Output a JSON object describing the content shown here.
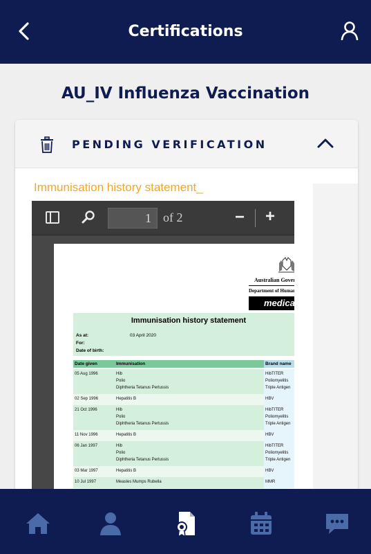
{
  "header": {
    "title": "Certifications"
  },
  "page": {
    "title": "AU_IV Influenza Vaccination"
  },
  "card": {
    "status": "PENDING VERIFICATION",
    "document_title": "Immunisation history statement_"
  },
  "viewer": {
    "page_number": "1",
    "page_total": "of 2"
  },
  "document": {
    "gov_line1": "Australian Gover",
    "gov_line2": "Department of Human",
    "medicare": "medicare",
    "title": "Immunisation history statement",
    "as_at_label": "As at:",
    "as_at_value": "03 April 2020",
    "for_label": "For:",
    "dob_label": "Date of birth:",
    "columns": [
      "Date given",
      "Immunisation",
      "Brand name"
    ],
    "rows": [
      {
        "date": "05 Aug 1996",
        "immunisations": [
          "Hib",
          "Polio",
          "Diphtheria Tetanus Pertussis"
        ],
        "brands": [
          "HibTITER",
          "Poliomyelitis",
          "Triple Antigen"
        ]
      },
      {
        "date": "02 Sep 1996",
        "immunisations": [
          "Hepatitis B"
        ],
        "brands": [
          "HBV"
        ]
      },
      {
        "date": "21 Oct 1996",
        "immunisations": [
          "Hib",
          "Polio",
          "Diphtheria Tetanus Pertussis"
        ],
        "brands": [
          "HibTITER",
          "Poliomyelitis",
          "Triple Antigen"
        ]
      },
      {
        "date": "11 Nov 1996",
        "immunisations": [
          "Hepatitis B"
        ],
        "brands": [
          "HBV"
        ]
      },
      {
        "date": "06 Jan 1997",
        "immunisations": [
          "Hib",
          "Polio",
          "Diphtheria Tetanus Pertussis"
        ],
        "brands": [
          "HibTITER",
          "Poliomyelitis",
          "Triple Antigen"
        ]
      },
      {
        "date": "03 Mar 1997",
        "immunisations": [
          "Hepatitis B"
        ],
        "brands": [
          "HBV"
        ]
      },
      {
        "date": "10 Jul 1997",
        "immunisations": [
          "Measles Mumps Rubella"
        ],
        "brands": [
          "MMR"
        ]
      }
    ]
  },
  "tabs": [
    {
      "icon": "home-icon"
    },
    {
      "icon": "profile-icon"
    },
    {
      "icon": "certificate-icon",
      "active": true
    },
    {
      "icon": "calendar-icon"
    },
    {
      "icon": "chat-icon"
    }
  ],
  "colors": {
    "navy": "#0f1c52",
    "accent": "#f5a623",
    "tab_inactive": "#4a6aa8",
    "tab_active": "#ffffff"
  }
}
